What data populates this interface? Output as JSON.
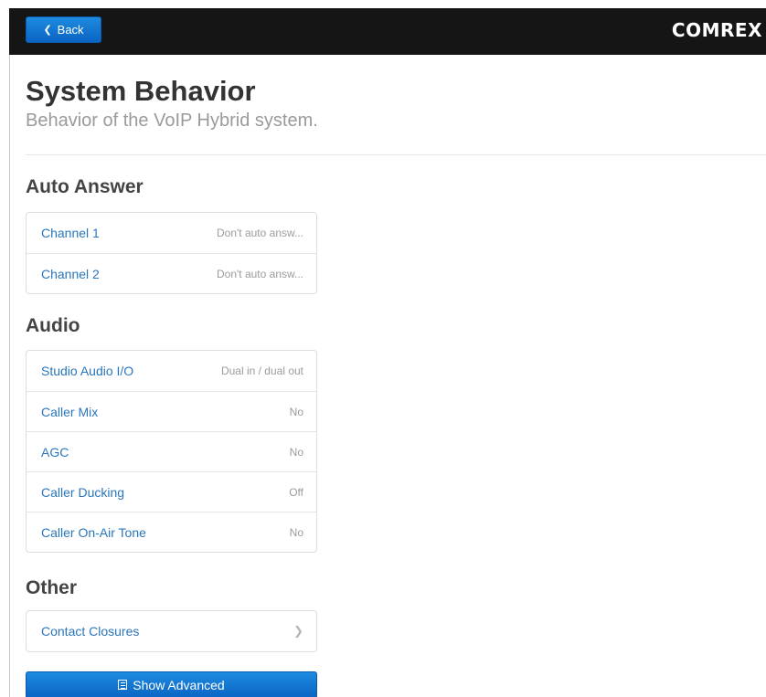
{
  "header": {
    "back_label": "Back",
    "logo_text": "COMREX"
  },
  "page": {
    "title": "System Behavior",
    "subtitle": "Behavior of the VoIP Hybrid system."
  },
  "sections": {
    "auto_answer": {
      "heading": "Auto Answer",
      "items": [
        {
          "label": "Channel 1",
          "value": "Don't auto answ..."
        },
        {
          "label": "Channel 2",
          "value": "Don't auto answ..."
        }
      ]
    },
    "audio": {
      "heading": "Audio",
      "items": [
        {
          "label": "Studio Audio I/O",
          "value": "Dual in / dual out"
        },
        {
          "label": "Caller Mix",
          "value": "No"
        },
        {
          "label": "AGC",
          "value": "No"
        },
        {
          "label": "Caller Ducking",
          "value": "Off"
        },
        {
          "label": "Caller On-Air Tone",
          "value": "No"
        }
      ]
    },
    "other": {
      "heading": "Other",
      "items": [
        {
          "label": "Contact Closures",
          "icon": "chevron-right-icon"
        }
      ]
    }
  },
  "footer": {
    "advanced_label": "Show Advanced",
    "advanced_icon": "list-icon"
  },
  "colors": {
    "navbar": "#151515",
    "button_blue": "#1277d1",
    "link_blue": "#2a76bd",
    "value_gray": "#9b9b9b"
  }
}
